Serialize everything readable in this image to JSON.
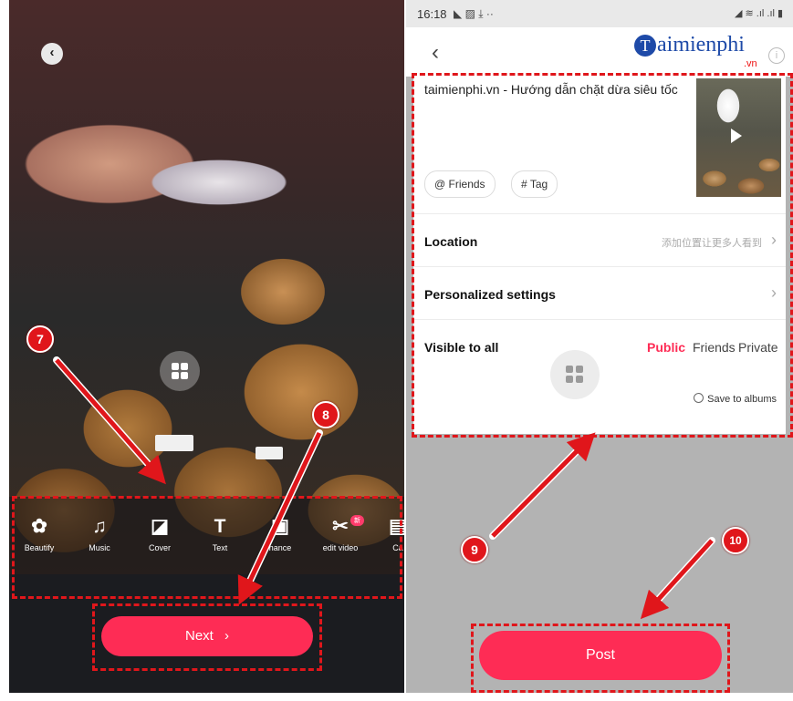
{
  "left_screen": {
    "back_icon": "chevron-left-icon",
    "center_icon": "grid-icon",
    "tools": [
      {
        "icon": "beautify-icon",
        "label": "Beautify"
      },
      {
        "icon": "music-icon",
        "label": "Music"
      },
      {
        "icon": "cover-icon",
        "label": "Cover"
      },
      {
        "icon": "text-icon",
        "label": "Text"
      },
      {
        "icon": "enhance-icon",
        "label": "hance"
      },
      {
        "icon": "edit-video-icon",
        "label": "edit video",
        "badge": "新"
      },
      {
        "icon": "cam-icon",
        "label": "Ca"
      }
    ],
    "next_button": {
      "label": "Next",
      "icon": "chevron-right-icon"
    }
  },
  "right_screen": {
    "status_bar": {
      "time": "16:18",
      "left_icons": "◣ ▨ ⤓ ··",
      "right_icons": "◢ ≋ .ıl .ıl ▮"
    },
    "header": {
      "back_icon": "chevron-left-icon",
      "logo_text": "aimienphi",
      "logo_initial": "T",
      "logo_suffix": ".vn",
      "info_icon": "info-icon"
    },
    "caption": "taimienphi.vn - Hướng dẫn chặt dừa siêu tốc",
    "thumbnail_play_icon": "play-icon",
    "chips": [
      {
        "icon_glyph": "@",
        "label": "Friends"
      },
      {
        "icon_glyph": "#",
        "label": "Tag"
      }
    ],
    "location": {
      "label": "Location",
      "hint": "添加位置让更多人看到"
    },
    "personalized": {
      "label": "Personalized settings"
    },
    "visibility": {
      "label": "Visible to all",
      "options": [
        "Public",
        "Friends",
        "Private"
      ],
      "selected": "Public"
    },
    "save_to_albums": "Save to albums",
    "post_button": {
      "label": "Post"
    }
  },
  "annotations": {
    "steps": [
      "7",
      "8",
      "9",
      "10"
    ]
  },
  "colors": {
    "accent": "#fe2c55",
    "annotation_red": "#e0161b",
    "logo_blue": "#1e4aa8"
  }
}
